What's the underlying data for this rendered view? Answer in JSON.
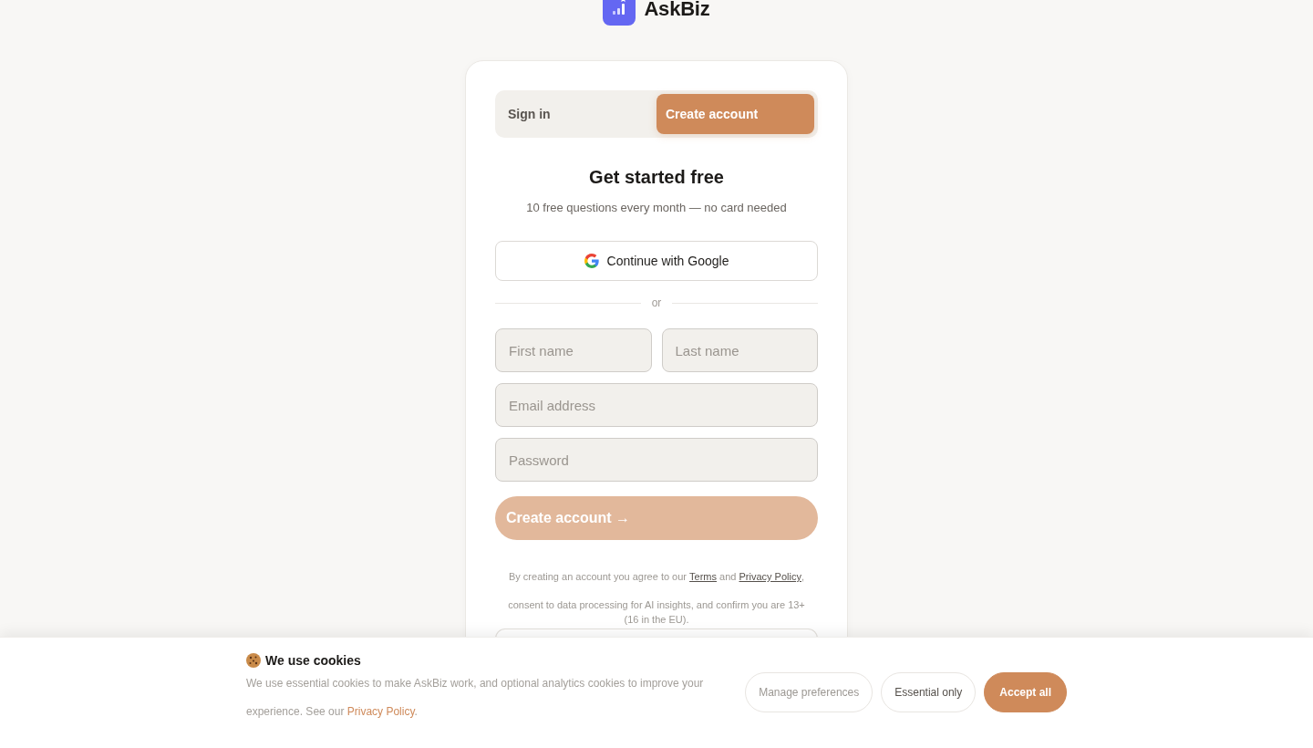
{
  "logo": {
    "name": "AskBiz"
  },
  "auth_card": {
    "tabs": [
      {
        "label": "Sign in",
        "selected": false
      },
      {
        "label": "Create account",
        "selected": true
      }
    ],
    "title": "Get started free",
    "subtitle": "10 free questions every month — no card needed",
    "google_button": "Continue with Google",
    "divider": "or",
    "fields": [
      {
        "kind": "half",
        "placeholder": "First name"
      },
      {
        "kind": "half",
        "placeholder": "Last name"
      },
      {
        "kind": "full",
        "placeholder": "Email address"
      },
      {
        "kind": "full",
        "placeholder": "Password"
      }
    ],
    "submit_button": {
      "label": "Create account →",
      "disabled": true
    },
    "legal": {
      "before": "By creating an account you agree to our",
      "terms_link": "Terms",
      "middle": "and",
      "privacy_link": "Privacy Policy",
      "after": ", consent to data processing for AI insights, and confirm you are 13+ (16 in the EU)."
    }
  },
  "cookie_banner": {
    "title": "We use cookies",
    "text": "We use essential cookies to make AskBiz work, and optional analytics cookies to improve your experience. See our",
    "link": "Privacy Policy",
    "after": ".",
    "buttons": [
      {
        "label": "Manage preferences",
        "kind": "ghost"
      },
      {
        "label": "Essential only",
        "kind": "outline"
      },
      {
        "label": "Accept all",
        "kind": "primary"
      }
    ]
  }
}
